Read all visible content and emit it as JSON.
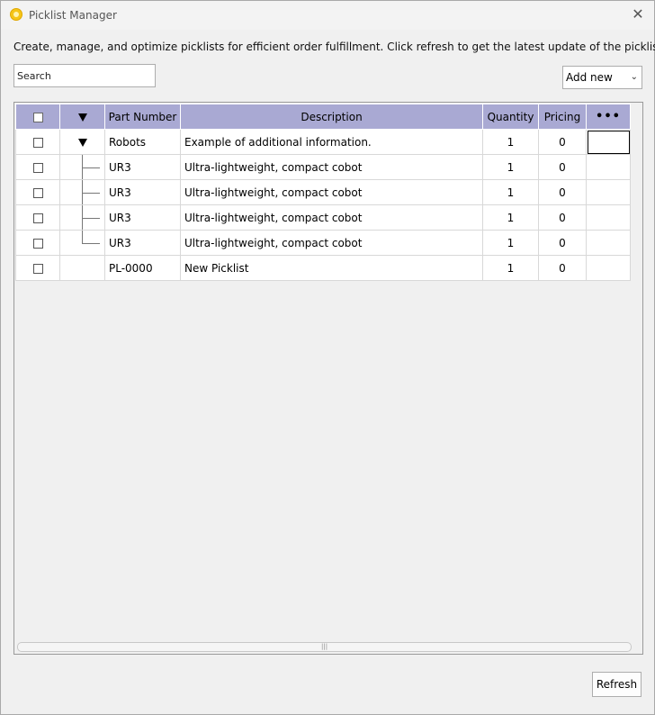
{
  "window": {
    "title": "Picklist Manager",
    "close_glyph": "✕",
    "description": "Create, manage, and optimize picklists for efficient order fulfillment. Click refresh to get the latest update of the picklist."
  },
  "search": {
    "placeholder": "Search"
  },
  "add_new": {
    "label": "Add new",
    "chevron": "⌄"
  },
  "grid": {
    "columns": {
      "part_number": "Part Number",
      "description": "Description",
      "quantity": "Quantity",
      "pricing": "Pricing",
      "more": "•••"
    },
    "rows": [
      {
        "part": "Robots",
        "description": "Example of additional information.",
        "quantity": "1",
        "pricing": "0"
      },
      {
        "part": "UR3",
        "description": "Ultra-lightweight, compact cobot",
        "quantity": "1",
        "pricing": "0"
      },
      {
        "part": "UR3",
        "description": "Ultra-lightweight, compact cobot",
        "quantity": "1",
        "pricing": "0"
      },
      {
        "part": "UR3",
        "description": "Ultra-lightweight, compact cobot",
        "quantity": "1",
        "pricing": "0"
      },
      {
        "part": "UR3",
        "description": "Ultra-lightweight, compact cobot",
        "quantity": "1",
        "pricing": "0"
      },
      {
        "part": "PL-0000",
        "description": "New Picklist",
        "quantity": "1",
        "pricing": "0"
      }
    ]
  },
  "footer": {
    "refresh_label": "Refresh"
  },
  "colors": {
    "header_bg": "#a9a9d3",
    "window_bg": "#f0f0f0",
    "app_icon": "#f5c518"
  }
}
